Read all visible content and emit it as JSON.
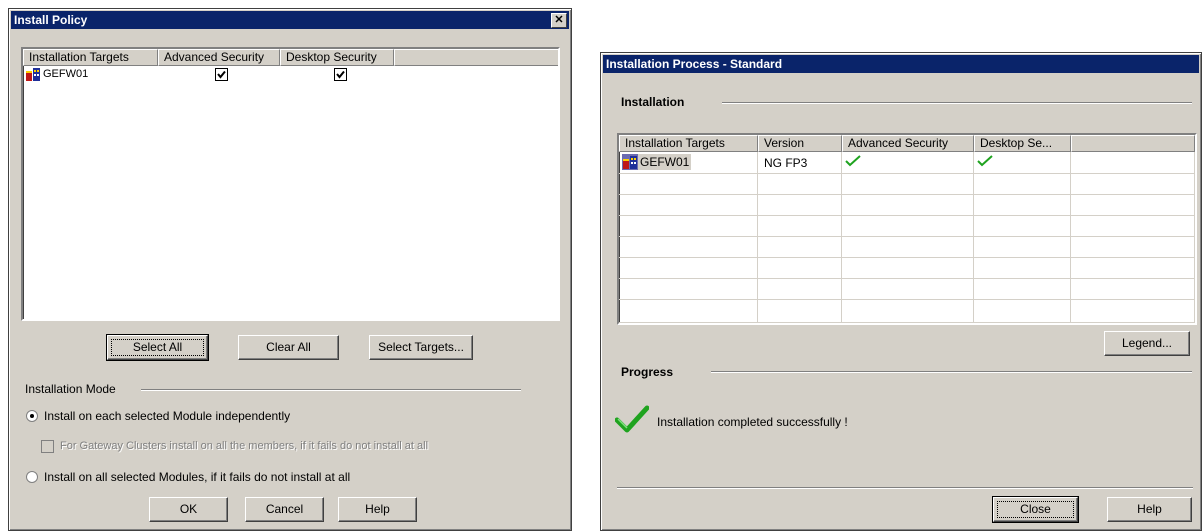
{
  "install_policy": {
    "title": "Install Policy",
    "close_glyph": "✕",
    "columns": [
      "Installation Targets",
      "Advanced Security",
      "Desktop Security"
    ],
    "rows": [
      {
        "target": "GEFW01",
        "advanced_security": true,
        "desktop_security": true
      }
    ],
    "buttons": {
      "select_all": "Select All",
      "clear_all": "Clear All",
      "select_targets": "Select Targets..."
    },
    "mode_label": "Installation Mode",
    "option_each": "Install on each selected Module independently",
    "option_clusters": "For Gateway Clusters install on all the members, if it fails do not install at all",
    "option_all": "Install on all selected Modules, if it fails do not install at all",
    "selected_option": "each",
    "footer": {
      "ok": "OK",
      "cancel": "Cancel",
      "help": "Help"
    }
  },
  "installation_process": {
    "title": "Installation Process  - Standard",
    "installation_group": "Installation",
    "columns": [
      "Installation Targets",
      "Version",
      "Advanced Security",
      "Desktop Se..."
    ],
    "rows": [
      {
        "target": "GEFW01",
        "version": "NG FP3",
        "advanced_security": "success",
        "desktop_security": "success"
      }
    ],
    "legend_button": "Legend...",
    "progress_group": "Progress",
    "status_message": "Installation completed successfully !",
    "footer": {
      "close": "Close",
      "help": "Help"
    }
  },
  "colors": {
    "titlebar": "#0a246a",
    "dialog": "#d4d0c8",
    "success_check": "#1fa31f"
  }
}
